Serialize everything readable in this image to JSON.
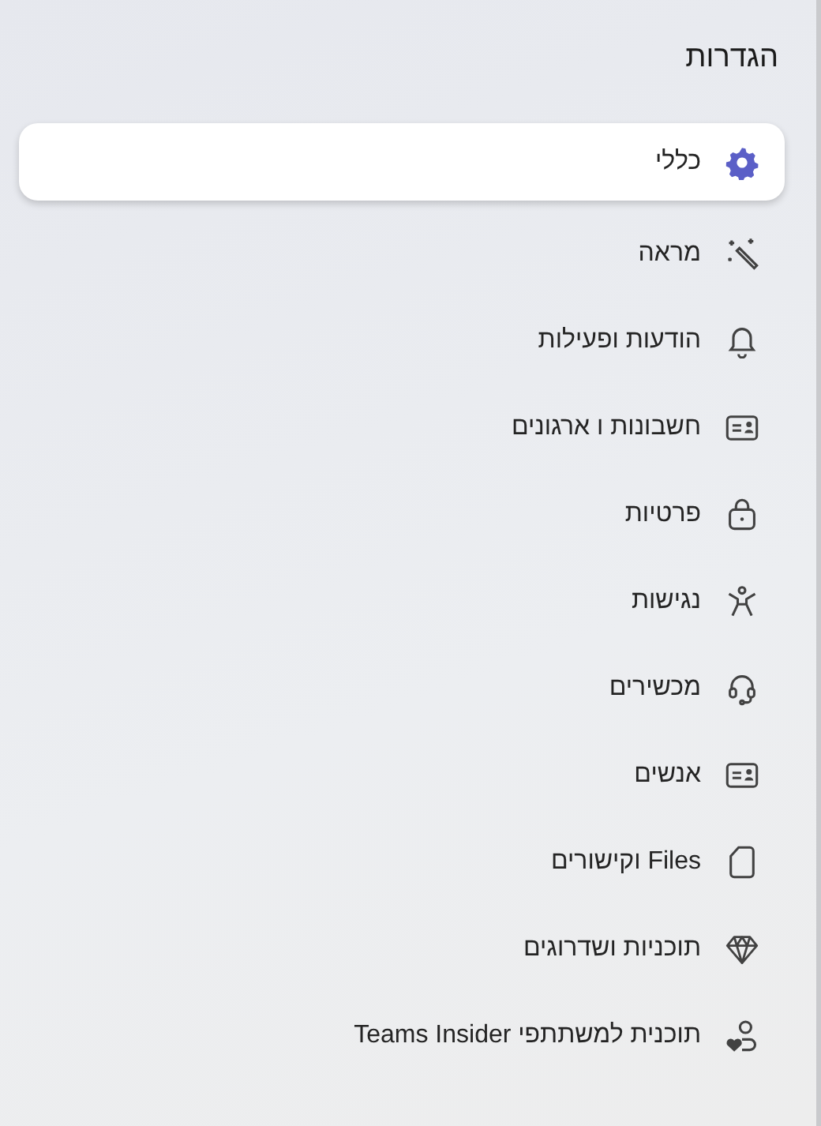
{
  "title": "הגדרות",
  "items": [
    {
      "label": "כללי",
      "kind": "gear",
      "selected": true
    },
    {
      "label": "מראה",
      "kind": "wand",
      "selected": false
    },
    {
      "label": "הודעות ופעילות",
      "kind": "bell",
      "selected": false
    },
    {
      "label": "חשבונות ו ארגונים",
      "kind": "card",
      "selected": false
    },
    {
      "label": "פרטיות",
      "kind": "lock",
      "selected": false
    },
    {
      "label": "נגישות",
      "kind": "person",
      "selected": false
    },
    {
      "label": "מכשירים",
      "kind": "headset",
      "selected": false
    },
    {
      "label": "אנשים",
      "kind": "card",
      "selected": false
    },
    {
      "label": "Files וקישורים",
      "kind": "file",
      "selected": false
    },
    {
      "label": "תוכניות ושדרוגים",
      "kind": "diamond",
      "selected": false
    },
    {
      "label": "תוכנית למשתתפי Teams Insider",
      "kind": "heart-person",
      "selected": false
    }
  ]
}
